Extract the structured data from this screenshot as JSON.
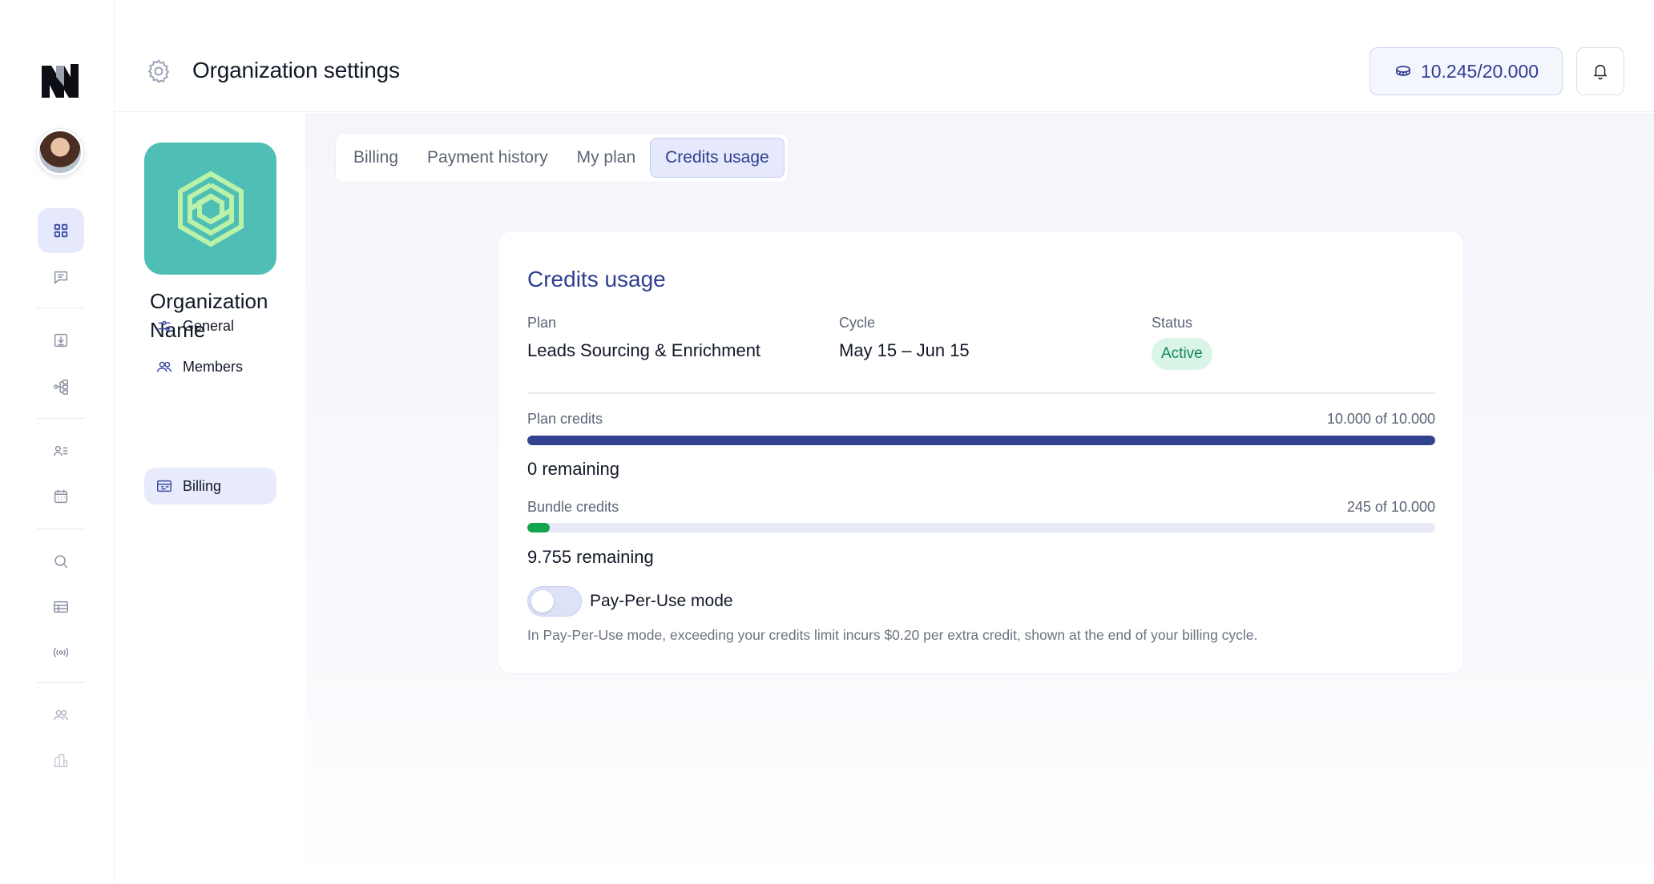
{
  "header": {
    "title": "Organization settings",
    "credits": "10.245/20.000"
  },
  "org": {
    "name": "Organization Name",
    "nav": [
      {
        "label": "General"
      },
      {
        "label": "Members"
      },
      {
        "label": "Billing"
      }
    ]
  },
  "tabs": [
    {
      "label": "Billing"
    },
    {
      "label": "Payment history"
    },
    {
      "label": "My plan"
    },
    {
      "label": "Credits usage"
    }
  ],
  "card": {
    "title": "Credits usage",
    "plan_label": "Plan",
    "plan_value": "Leads Sourcing & Enrichment",
    "cycle_label": "Cycle",
    "cycle_value": "May 15 – Jun 15",
    "status_label": "Status",
    "status_value": "Active",
    "plan_credits": {
      "label": "Plan credits",
      "count": "10.000 of 10.000",
      "used_fraction": 1.0,
      "remaining": "0 remaining"
    },
    "bundle_credits": {
      "label": "Bundle credits",
      "count": "245 of 10.000",
      "used_fraction": 0.0245,
      "remaining": "9.755 remaining"
    },
    "pay_per_use": {
      "label": "Pay-Per-Use mode",
      "enabled": false,
      "helper": "In Pay-Per-Use mode, exceeding your credits limit incurs $0.20 per extra credit, shown at the end of your billing cycle."
    }
  },
  "colors": {
    "accent": "#2f3e8f",
    "plan_bar": "#33428f",
    "bundle_bar": "#12a64f",
    "status_bg": "#d9f5e8",
    "status_text": "#11875c",
    "org_logo_bg": "#4fbfb5"
  },
  "icons": [
    "app-logo",
    "avatar",
    "dashboard-icon",
    "chat-icon",
    "download-icon",
    "flow-icon",
    "contacts-list-icon",
    "calendar-icon",
    "search-icon",
    "table-icon",
    "broadcast-icon",
    "users-icon",
    "building-icon",
    "gear-icon",
    "coins-icon",
    "bell-icon",
    "sliders-icon",
    "members-icon",
    "billing-icon"
  ]
}
